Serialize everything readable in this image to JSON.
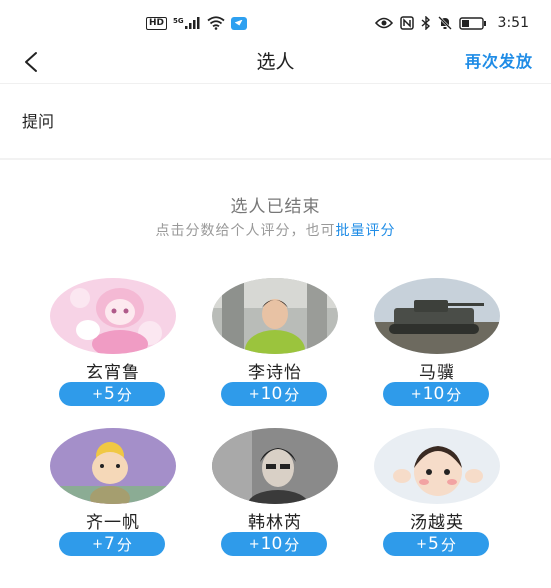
{
  "status_bar": {
    "hd": "HD",
    "signal": "5G",
    "time": "3:51"
  },
  "nav": {
    "title": "选人",
    "resend": "再次发放"
  },
  "question_label": "提问",
  "status": {
    "ended": "选人已结束",
    "hint_prefix": "点击分数给个人评分，也可",
    "hint_link": "批量评分"
  },
  "people": [
    {
      "name": "玄宵鲁",
      "plus": "+",
      "score": "5",
      "unit": "分"
    },
    {
      "name": "李诗怡",
      "plus": "+",
      "score": "10",
      "unit": "分"
    },
    {
      "name": "马骥",
      "plus": "+",
      "score": "10",
      "unit": "分"
    },
    {
      "name": "齐一帆",
      "plus": "+",
      "score": "7",
      "unit": "分"
    },
    {
      "name": "韩林芮",
      "plus": "+",
      "score": "10",
      "unit": "分"
    },
    {
      "name": "汤越英",
      "plus": "+",
      "score": "5",
      "unit": "分"
    }
  ],
  "colors": {
    "accent": "#1f8ce6",
    "score_pill": "#2f9bea"
  }
}
